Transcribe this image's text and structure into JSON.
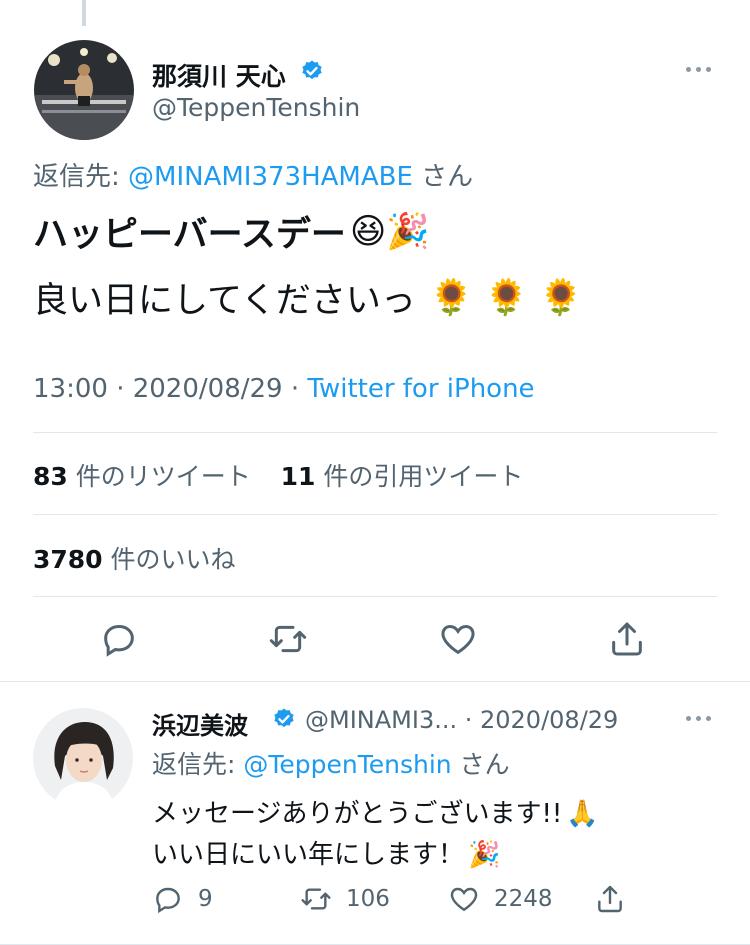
{
  "main_tweet": {
    "display_name": "那須川 天心",
    "handle": "@TeppenTenshin",
    "reply_to_prefix": "返信先: ",
    "reply_to_handle": "@MINAMI373HAMABE",
    "reply_to_suffix": " さん",
    "line1": "ハッピーバースデー",
    "line1_emojis": "😆🎉",
    "line2": "良い日にしてくださいっ",
    "line2_emojis": "🌻 🌻 🌻",
    "time": "13:00 · 2020/08/29 · ",
    "source": "Twitter for iPhone",
    "retweet_count": "83",
    "retweet_label": " 件のリツイート",
    "quote_count": "11",
    "quote_label": " 件の引用ツイート",
    "like_count": "3780",
    "like_label": " 件のいいね"
  },
  "reply_tweet": {
    "display_name": "浜辺美波",
    "handle_date": "@MINAMI3... · 2020/08/29",
    "reply_to_prefix": "返信先: ",
    "reply_to_handle": "@TeppenTenshin",
    "reply_to_suffix": " さん",
    "line1": "メッセージありがとうございます!!",
    "line1_emoji": "🙏",
    "line2": "いい日にいい年にします！",
    "line2_emoji": "🎉",
    "reply_count": "9",
    "retweet_count": "106",
    "like_count": "2248"
  },
  "icons": {
    "verified": "verified-badge-icon",
    "more": "more-options-icon",
    "reply": "reply-icon",
    "retweet": "retweet-icon",
    "like": "heart-icon",
    "share": "share-icon"
  },
  "colors": {
    "link": "#1d9bf0",
    "secondary_text": "#536471",
    "divider": "#e1e8ed"
  }
}
